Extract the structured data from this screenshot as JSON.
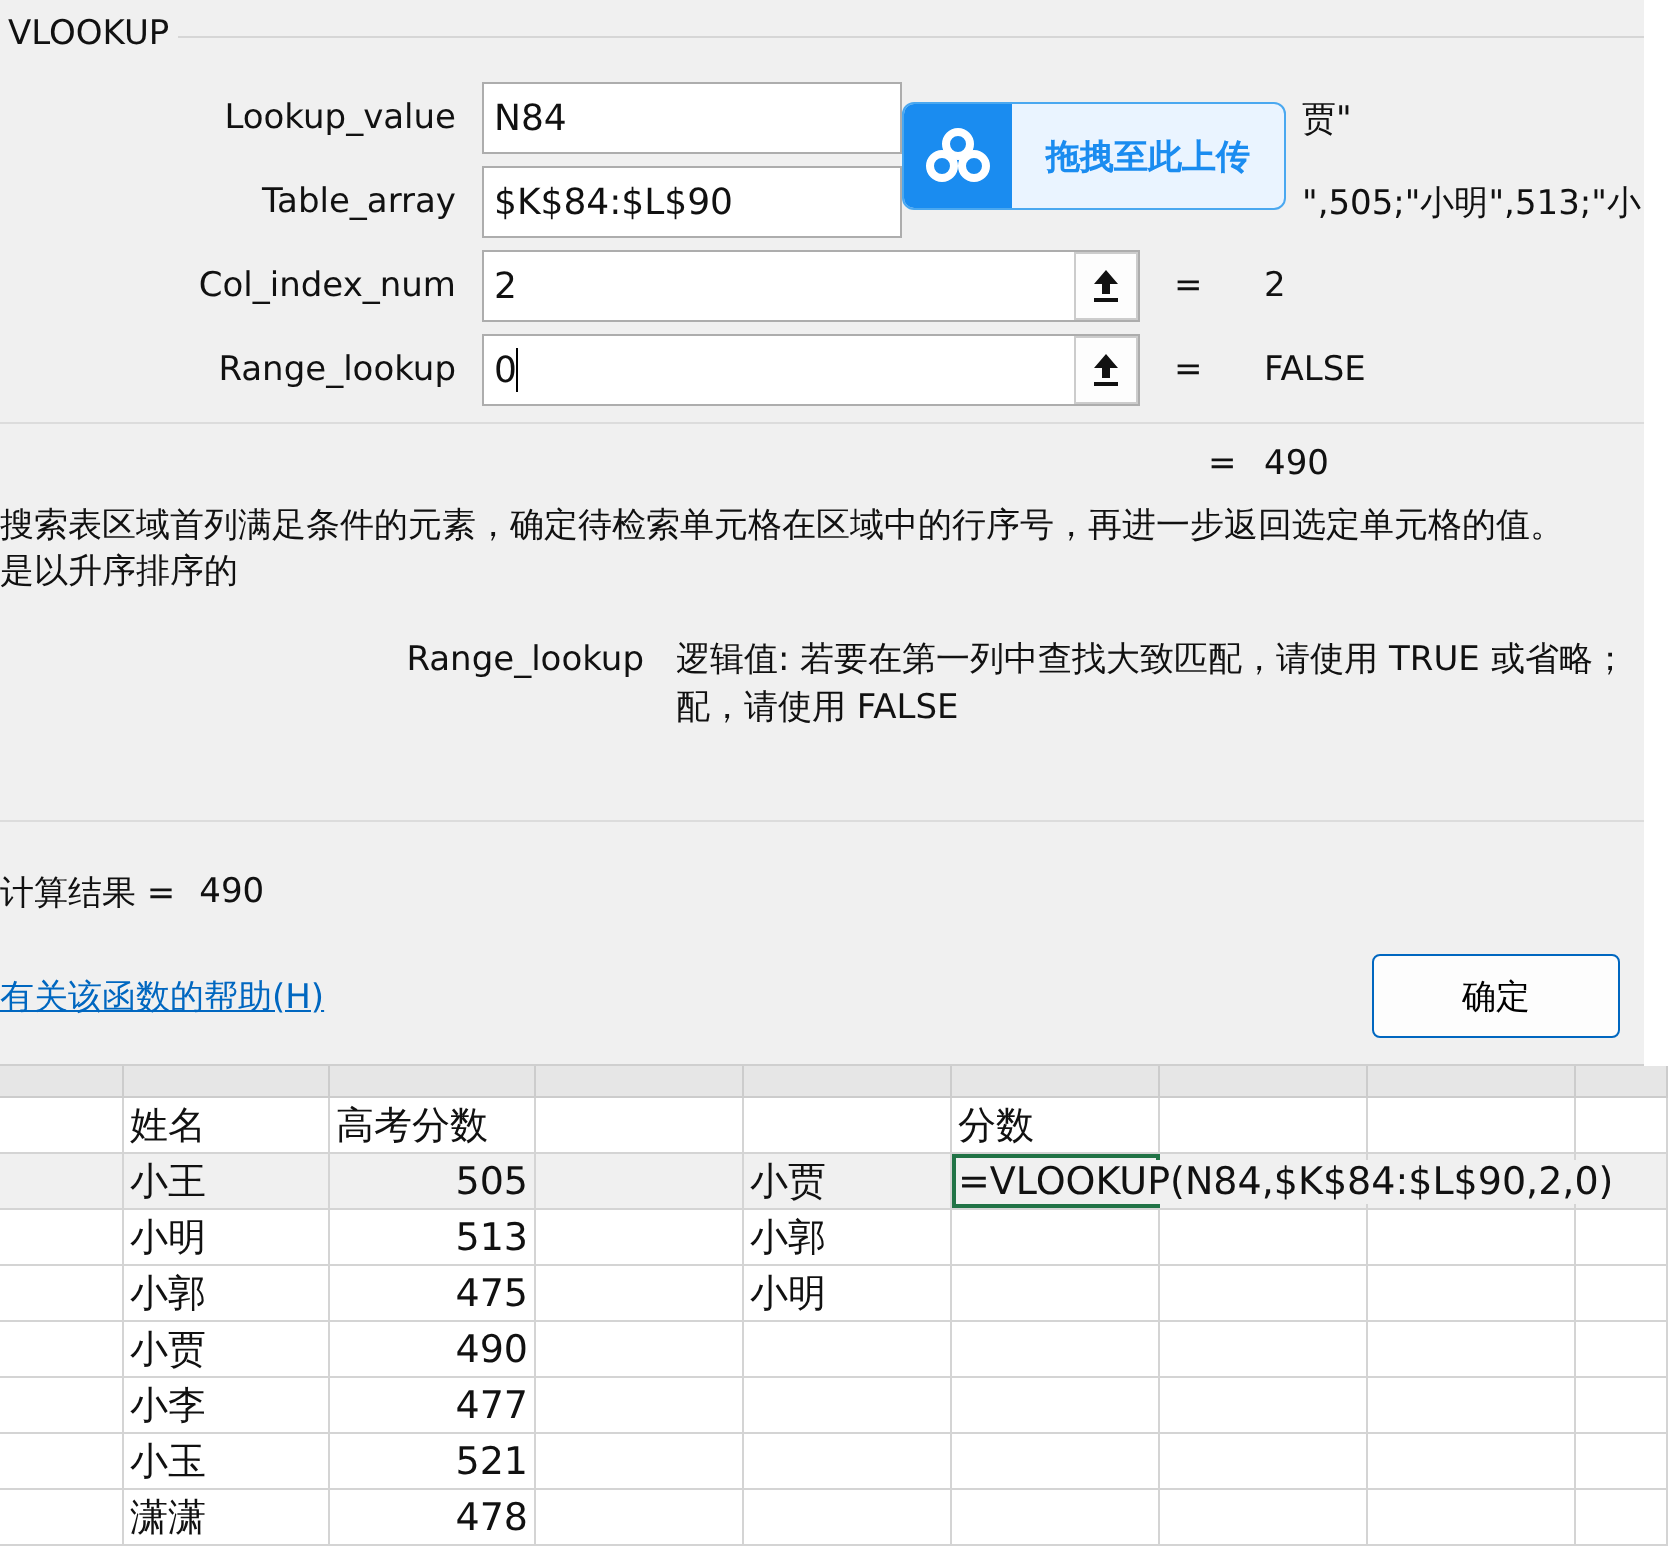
{
  "dialog": {
    "group_title": "VLOOKUP",
    "arguments": [
      {
        "label": "Lookup_value",
        "value": "N84",
        "result": "贾\"",
        "cursor": false
      },
      {
        "label": "Table_array",
        "value": "$K$84:$L$90",
        "result": "\",505;\"小明\",513;\"小",
        "cursor": false
      },
      {
        "label": "Col_index_num",
        "value": "2",
        "equals": "=",
        "result": "2",
        "cursor": false
      },
      {
        "label": "Range_lookup",
        "value": "0",
        "equals": "=",
        "result": "FALSE",
        "cursor": true
      }
    ],
    "formula_result": {
      "equals": "=",
      "value": "490"
    },
    "description": [
      "搜索表区域首列满足条件的元素，确定待检索单元格在区域中的行序号，再进一步返回选定单元格的值。",
      "是以升序排序的"
    ],
    "argument_help": {
      "name": "Range_lookup",
      "lines": [
        "逻辑值: 若要在第一列中查找大致匹配，请使用 TRUE 或省略；",
        "配，请使用 FALSE"
      ]
    },
    "calc_result": {
      "label": "计算结果 =",
      "value": "490"
    },
    "help_link": "有关该函数的帮助(H)",
    "ok_button": "确定"
  },
  "upload_overlay": {
    "label": "拖拽至此上传"
  },
  "sheet": {
    "header": {
      "name": "姓名",
      "score": "高考分数",
      "result": "分数"
    },
    "rows": [
      {
        "name": "小王",
        "score": "505",
        "lookup": "小贾",
        "result": "=VLOOKUP(N84,$K$84:$L$90,2,0)",
        "selected": true
      },
      {
        "name": "小明",
        "score": "513",
        "lookup": "小郭",
        "selected": false
      },
      {
        "name": "小郭",
        "score": "475",
        "lookup": "小明",
        "selected": false
      },
      {
        "name": "小贾",
        "score": "490",
        "selected": false
      },
      {
        "name": "小李",
        "score": "477",
        "selected": false
      },
      {
        "name": "小玉",
        "score": "521",
        "selected": false
      },
      {
        "name": "潇潇",
        "score": "478",
        "selected": false
      }
    ]
  }
}
